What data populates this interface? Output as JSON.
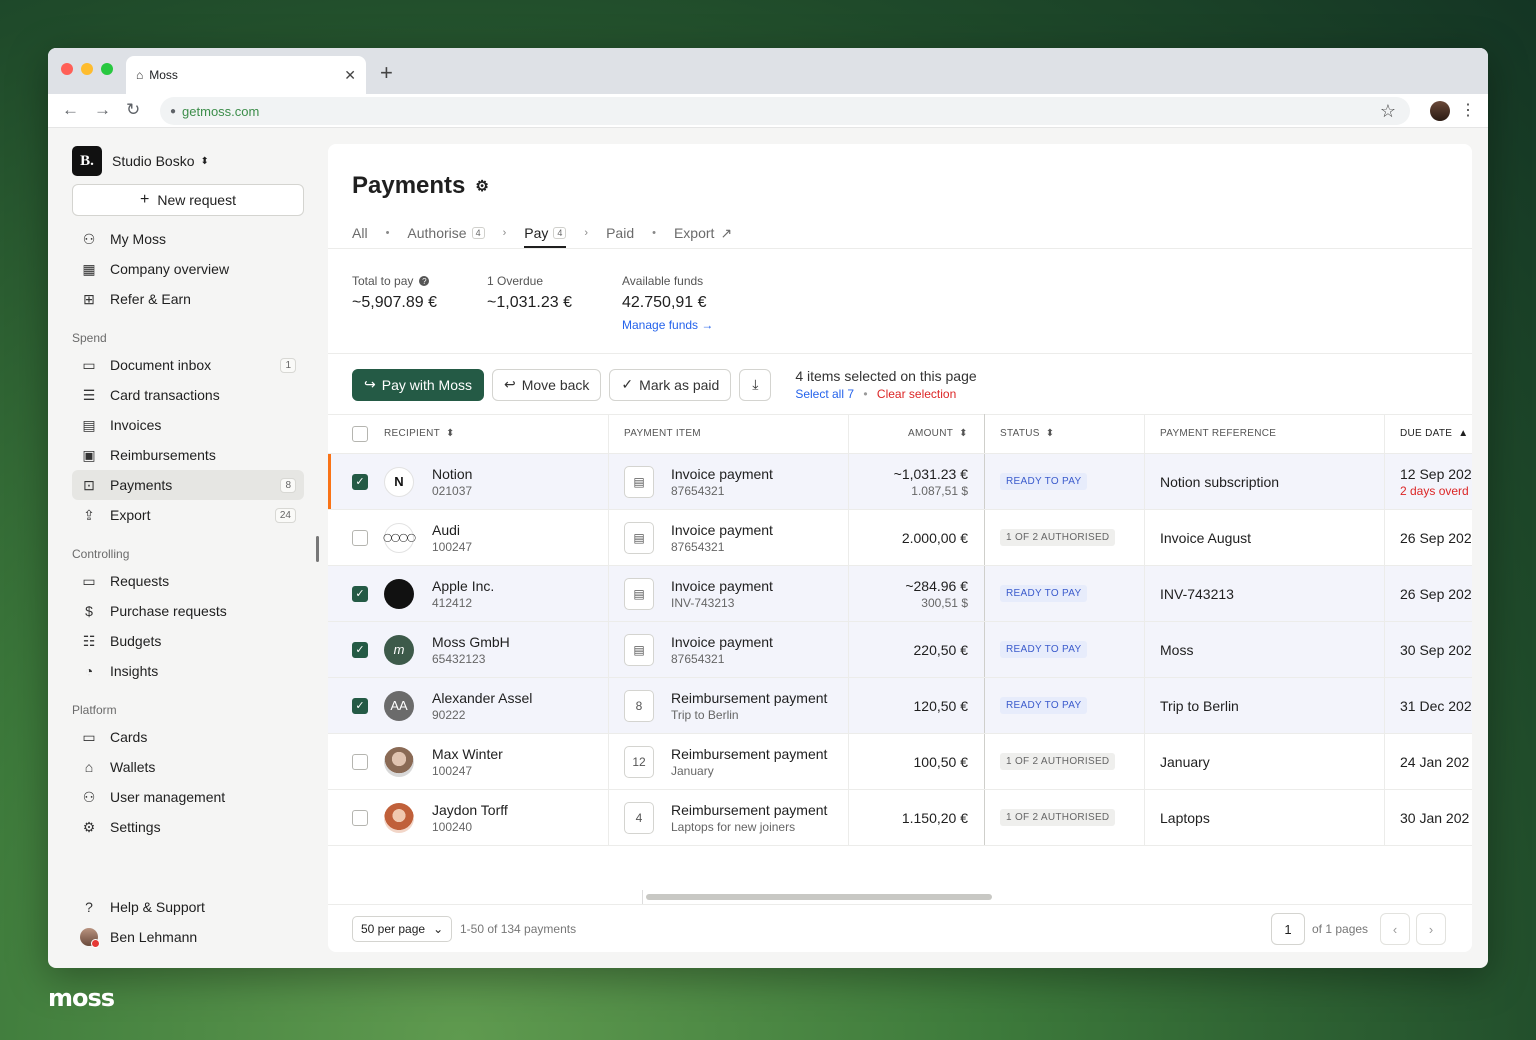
{
  "browser": {
    "tab_title": "Moss",
    "url": "getmoss.com"
  },
  "sidebar": {
    "org_name": "Studio Bosko",
    "org_logo": "B.",
    "new_request": "New request",
    "top_items": [
      {
        "label": "My Moss",
        "icon": "person-icon"
      },
      {
        "label": "Company overview",
        "icon": "building-icon"
      },
      {
        "label": "Refer & Earn",
        "icon": "gift-icon"
      }
    ],
    "spend_title": "Spend",
    "spend_items": [
      {
        "label": "Document inbox",
        "badge": "1"
      },
      {
        "label": "Card transactions",
        "badge": ""
      },
      {
        "label": "Invoices",
        "badge": ""
      },
      {
        "label": "Reimbursements",
        "badge": ""
      },
      {
        "label": "Payments",
        "badge": "8"
      },
      {
        "label": "Export",
        "badge": "24"
      }
    ],
    "controlling_title": "Controlling",
    "controlling_items": [
      {
        "label": "Requests"
      },
      {
        "label": "Purchase requests"
      },
      {
        "label": "Budgets"
      },
      {
        "label": "Insights"
      }
    ],
    "platform_title": "Platform",
    "platform_items": [
      {
        "label": "Cards"
      },
      {
        "label": "Wallets"
      },
      {
        "label": "User management"
      },
      {
        "label": "Settings"
      }
    ],
    "help": "Help & Support",
    "user": "Ben Lehmann"
  },
  "page": {
    "title": "Payments",
    "tabs": [
      {
        "label": "All",
        "count": ""
      },
      {
        "label": "Authorise",
        "count": "4"
      },
      {
        "label": "Pay",
        "count": "4"
      },
      {
        "label": "Paid",
        "count": ""
      },
      {
        "label": "Export",
        "count": ""
      }
    ],
    "stats": {
      "total_label": "Total to pay",
      "total_value": "~5,907.89 €",
      "overdue_label": "1 Overdue",
      "overdue_value": "~1,031.23 €",
      "funds_label": "Available funds",
      "funds_value": "42.750,91 €",
      "manage_link": "Manage funds"
    },
    "actions": {
      "pay": "Pay with Moss",
      "move_back": "Move back",
      "mark_paid": "Mark as paid",
      "selection_text": "4 items selected on this page",
      "select_all": "Select all 7",
      "clear": "Clear selection"
    }
  },
  "table": {
    "headers": {
      "recipient": "RECIPIENT",
      "item": "PAYMENT ITEM",
      "amount": "AMOUNT",
      "status": "STATUS",
      "reference": "PAYMENT REFERENCE",
      "due": "DUE DATE"
    },
    "rows": [
      {
        "checked": true,
        "name": "Notion",
        "id": "021037",
        "avatar": "N",
        "item": "Invoice payment",
        "item_sub": "87654321",
        "doc": "▤",
        "amount": "~1,031.23 €",
        "amount_sub": "1.087,51 $",
        "status": "READY TO PAY",
        "status_kind": "ready",
        "reference": "Notion subscription",
        "due": "12 Sep 202",
        "due_sub": "2 days overd"
      },
      {
        "checked": false,
        "name": "Audi",
        "id": "100247",
        "avatar": "◯◯◯◯",
        "item": "Invoice payment",
        "item_sub": "87654321",
        "doc": "▤",
        "amount": "2.000,00 €",
        "amount_sub": "",
        "status": "1 OF 2 AUTHORISED",
        "status_kind": "auth",
        "reference": "Invoice August",
        "due": "26 Sep 202",
        "due_sub": ""
      },
      {
        "checked": true,
        "name": "Apple Inc.",
        "id": "412412",
        "avatar": "",
        "item": "Invoice payment",
        "item_sub": "INV-743213",
        "doc": "▤",
        "amount": "~284.96 €",
        "amount_sub": "300,51 $",
        "status": "READY TO PAY",
        "status_kind": "ready",
        "reference": "INV-743213",
        "due": "26 Sep 202",
        "due_sub": ""
      },
      {
        "checked": true,
        "name": "Moss GmbH",
        "id": "65432123",
        "avatar": "m",
        "item": "Invoice payment",
        "item_sub": "87654321",
        "doc": "▤",
        "amount": "220,50 €",
        "amount_sub": "",
        "status": "READY TO PAY",
        "status_kind": "ready",
        "reference": "Moss",
        "due": "30 Sep 202",
        "due_sub": ""
      },
      {
        "checked": true,
        "name": "Alexander Assel",
        "id": "90222",
        "avatar": "AA",
        "item": "Reimbursement payment",
        "item_sub": "Trip to Berlin",
        "doc": "8",
        "amount": "120,50 €",
        "amount_sub": "",
        "status": "READY TO PAY",
        "status_kind": "ready",
        "reference": "Trip to Berlin",
        "due": "31 Dec 202",
        "due_sub": ""
      },
      {
        "checked": false,
        "name": "Max Winter",
        "id": "100247",
        "avatar": "",
        "item": "Reimbursement payment",
        "item_sub": "January",
        "doc": "12",
        "amount": "100,50 €",
        "amount_sub": "",
        "status": "1 OF 2 AUTHORISED",
        "status_kind": "auth",
        "reference": "January",
        "due": "24 Jan 202",
        "due_sub": ""
      },
      {
        "checked": false,
        "name": "Jaydon Torff",
        "id": "100240",
        "avatar": "",
        "item": "Reimbursement payment",
        "item_sub": "Laptops for new joiners",
        "doc": "4",
        "amount": "1.150,20 €",
        "amount_sub": "",
        "status": "1 OF 2 AUTHORISED",
        "status_kind": "auth",
        "reference": "Laptops",
        "due": "30 Jan 202",
        "due_sub": ""
      }
    ]
  },
  "footer": {
    "per_page": "50 per page",
    "range": "1-50 of 134 payments",
    "page": "1",
    "of_pages": "of 1 pages"
  },
  "brand": "moss",
  "colors": {
    "primary": "#245a45",
    "link": "#2563eb",
    "danger": "#dc2626",
    "row_marker": "#f97316"
  }
}
